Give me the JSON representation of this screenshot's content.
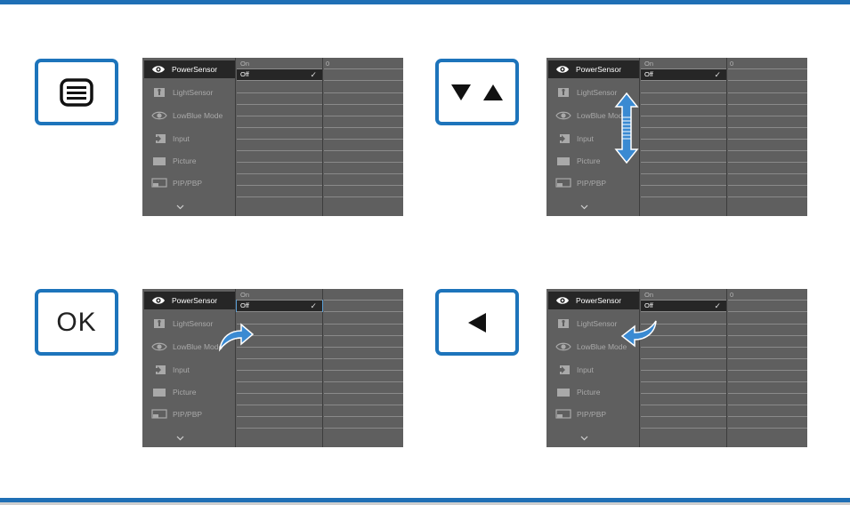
{
  "osd_menu": {
    "items": [
      {
        "label": "PowerSensor",
        "icon": "eye-icon"
      },
      {
        "label": "LightSensor",
        "icon": "light-sensor-icon"
      },
      {
        "label": "LowBlue Mode",
        "icon": "lowblue-eye-icon"
      },
      {
        "label": "Input",
        "icon": "input-icon"
      },
      {
        "label": "Picture",
        "icon": "picture-icon"
      },
      {
        "label": "PIP/PBP",
        "icon": "pip-icon"
      }
    ],
    "submenu": [
      "On",
      "Off"
    ],
    "value": "0",
    "more_icon": "chevron-down-icon",
    "check": "✓"
  },
  "steps": [
    {
      "key_icon": "menu-icon",
      "key_label": "",
      "show_value": true,
      "arrow": "none"
    },
    {
      "key_icon": "down-up-triangles-icon",
      "key_label": "",
      "show_value": true,
      "arrow": "vertical-scroll-arrow"
    },
    {
      "key_icon": "ok-icon",
      "key_label": "OK",
      "show_value": false,
      "arrow": "curved-right-arrow"
    },
    {
      "key_icon": "left-triangle-icon",
      "key_label": "",
      "show_value": true,
      "arrow": "curved-left-arrow"
    }
  ],
  "colors": {
    "accent": "#1d74bb",
    "osd_bg": "#5f5f5f",
    "osd_selected": "#262626",
    "arrow_blue": "#3a8ad2"
  }
}
